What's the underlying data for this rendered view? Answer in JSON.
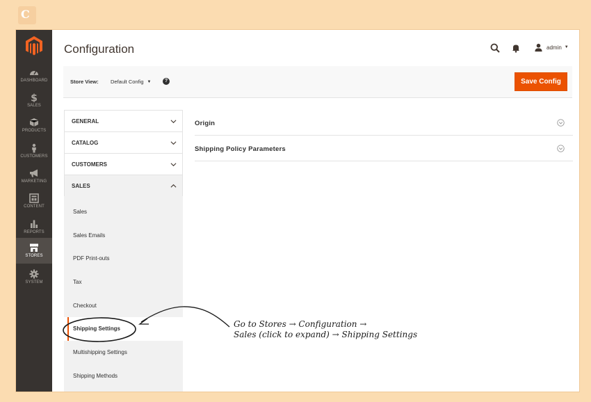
{
  "admin_nav": {
    "items": [
      {
        "label": "DASHBOARD",
        "icon": "dashboard-icon"
      },
      {
        "label": "SALES",
        "icon": "dollar-icon"
      },
      {
        "label": "PRODUCTS",
        "icon": "cube-icon"
      },
      {
        "label": "CUSTOMERS",
        "icon": "person-icon"
      },
      {
        "label": "MARKETING",
        "icon": "megaphone-icon"
      },
      {
        "label": "CONTENT",
        "icon": "content-icon"
      },
      {
        "label": "REPORTS",
        "icon": "bar-chart-icon"
      },
      {
        "label": "STORES",
        "icon": "store-icon"
      },
      {
        "label": "SYSTEM",
        "icon": "gear-icon"
      }
    ],
    "active": "STORES"
  },
  "header": {
    "title": "Configuration",
    "user": "admin"
  },
  "store_view": {
    "label": "Store View:",
    "value": "Default Config",
    "save_label": "Save Config"
  },
  "config_tabs": {
    "groups": [
      {
        "label": "GENERAL"
      },
      {
        "label": "CATALOG"
      },
      {
        "label": "CUSTOMERS"
      },
      {
        "label": "SALES"
      }
    ],
    "sales_items": [
      {
        "label": "Sales"
      },
      {
        "label": "Sales Emails"
      },
      {
        "label": "PDF Print-outs"
      },
      {
        "label": "Tax"
      },
      {
        "label": "Checkout"
      },
      {
        "label": "Shipping Settings"
      },
      {
        "label": "Multishipping Settings"
      },
      {
        "label": "Shipping Methods"
      }
    ],
    "active_item": "Shipping Settings"
  },
  "sections": [
    {
      "title": "Origin"
    },
    {
      "title": "Shipping Policy Parameters"
    }
  ],
  "annotation": {
    "line1": "Go to Stores → Configuration →",
    "line2": "Sales (click to expand) → Shipping Settings"
  },
  "colors": {
    "page_background": "#fbdcb1",
    "admin_nav": "#373330",
    "accent": "#eb5202"
  }
}
